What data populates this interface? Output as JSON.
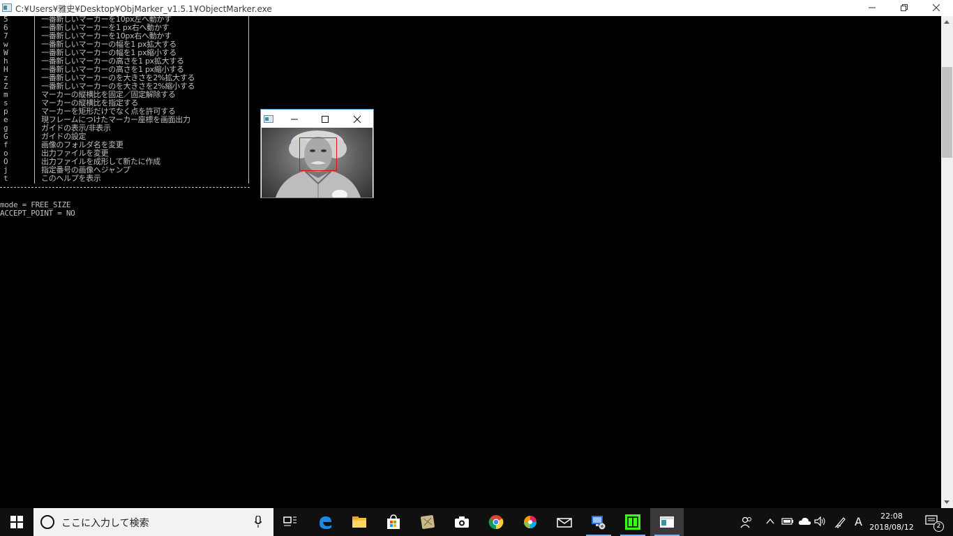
{
  "window": {
    "title": "C:¥Users¥雅史¥Desktop¥ObjMarker_v1.5.1¥ObjectMarker.exe"
  },
  "help_rows": [
    {
      "key": "5",
      "desc": "一番新しいマーカーを10px左へ動かす"
    },
    {
      "key": "6",
      "desc": "一番新しいマーカーを1 px右へ動かす"
    },
    {
      "key": "7",
      "desc": "一番新しいマーカーを10px右へ動かす"
    },
    {
      "key": "w",
      "desc": "一番新しいマーカーの幅を1 px拡大する"
    },
    {
      "key": "W",
      "desc": "一番新しいマーカーの幅を1 px縮小する"
    },
    {
      "key": "h",
      "desc": "一番新しいマーカーの高さを1 px拡大する"
    },
    {
      "key": "H",
      "desc": "一番新しいマーカーの高さを1 px縮小する"
    },
    {
      "key": "z",
      "desc": "一番新しいマーカーのを大きさを2%拡大する"
    },
    {
      "key": "Z",
      "desc": "一番新しいマーカーのを大きさを2%縮小する"
    },
    {
      "key": "m",
      "desc": "マーカーの縦横比を固定／固定解除する"
    },
    {
      "key": "s",
      "desc": "マーカーの縦横比を指定する"
    },
    {
      "key": "p",
      "desc": "マーカーを矩形だけでなく点を許可する"
    },
    {
      "key": "e",
      "desc": "現フレームにつけたマーカー座標を画面出力"
    },
    {
      "key": "g",
      "desc": "ガイドの表示/非表示"
    },
    {
      "key": "G",
      "desc": "ガイドの設定"
    },
    {
      "key": "f",
      "desc": "画像のフォルダ名を変更"
    },
    {
      "key": "o",
      "desc": "出力ファイルを変更"
    },
    {
      "key": "O",
      "desc": "出力ファイルを成形して新たに作成"
    },
    {
      "key": "j",
      "desc": "指定番号の画像へジャンプ"
    },
    {
      "key": "t",
      "desc": "このヘルプを表示"
    }
  ],
  "status": {
    "mode": "mode = FREE_SIZE",
    "accept_point": "ACCEPT_POINT = NO"
  },
  "taskbar": {
    "search_placeholder": "ここに入力して検索",
    "ime": "A",
    "time": "22:08",
    "date": "2018/08/12",
    "notification_count": "2"
  },
  "colors": {
    "console_text": "#c0c0c0",
    "marker": "#e01010",
    "accent": "#3a8ed8"
  }
}
